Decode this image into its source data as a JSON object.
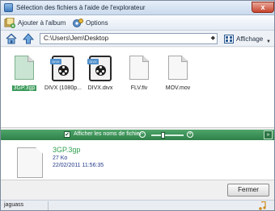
{
  "window": {
    "title": "Sélection des fichiers à l'aide de l'explorateur",
    "close_glyph": "x"
  },
  "toolbar": {
    "add_to_album": "Ajouter à l'album",
    "options": "Options"
  },
  "nav": {
    "home_icon": "home-icon",
    "up_icon": "up-arrow-icon",
    "address": "C:\\Users\\Jem\\Desktop",
    "view_label": "Affichage"
  },
  "files": [
    {
      "name": "3GP.3gp",
      "icon": "document-icon",
      "selected": true
    },
    {
      "name": "DIVX (1080p...",
      "icon": "divx-icon",
      "badge": "DIVX",
      "selected": false
    },
    {
      "name": "DIVX.divx",
      "icon": "divx-icon",
      "badge": "DIVX",
      "selected": false
    },
    {
      "name": "FLV.flv",
      "icon": "document-icon",
      "selected": false
    },
    {
      "name": "MOV.mov",
      "icon": "document-icon",
      "selected": false
    }
  ],
  "filebar": {
    "show_names_label": "Afficher les noms de fichier",
    "show_names_checked": true,
    "checkbox_glyph": "✔",
    "zoom_minus": "-",
    "zoom_plus": "+",
    "zoom_level": 0.35,
    "collapse_glyph": "»"
  },
  "details": {
    "name": "3GP.3gp",
    "size": "27 Ko",
    "date": "22/02/2011 11:56:35"
  },
  "footer": {
    "close_button": "Fermer"
  },
  "status": {
    "text": "jaguass"
  },
  "colors": {
    "accent_green": "#2e8048",
    "selection_green": "#3a9a5a",
    "detail_name": "#2f9f4f",
    "detail_meta": "#223a88"
  }
}
